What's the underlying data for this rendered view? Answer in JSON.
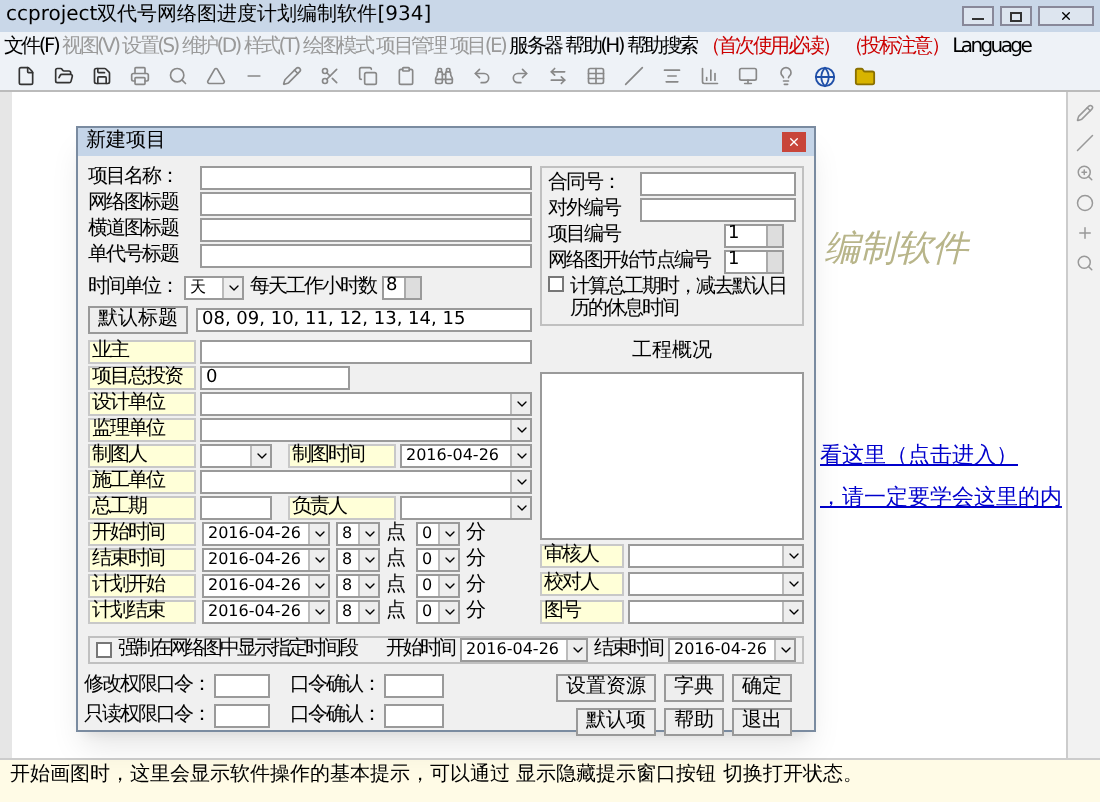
{
  "window": {
    "title": "ccproject双代号网络图进度计划编制软件[934]"
  },
  "menu": [
    {
      "label": "文件(F)",
      "disabled": false
    },
    {
      "label": "视图(V)",
      "disabled": true
    },
    {
      "label": "设置(S)",
      "disabled": true
    },
    {
      "label": "维护(D)",
      "disabled": true
    },
    {
      "label": "样式(T)",
      "disabled": true
    },
    {
      "label": "绘图模式",
      "disabled": true
    },
    {
      "label": "项目管理",
      "disabled": true
    },
    {
      "label": "项目(E)",
      "disabled": true
    },
    {
      "label": "服务器",
      "disabled": false
    },
    {
      "label": "帮助(H)",
      "disabled": false
    },
    {
      "label": "帮助搜索",
      "disabled": false
    },
    {
      "label": "（首次使用必读）",
      "disabled": false,
      "color": "#cc0000"
    },
    {
      "label": "（投标注意）",
      "disabled": false,
      "color": "#cc0000"
    },
    {
      "label": "Language",
      "disabled": false
    }
  ],
  "canvas": {
    "heading": "编制软件",
    "links": [
      "看这里（点击进入）",
      "，请一定要学会这里的内"
    ]
  },
  "dialog": {
    "title": "新建项目",
    "title_fields": [
      {
        "label": "项目名称："
      },
      {
        "label": "网络图标题"
      },
      {
        "label": "横道图标题"
      },
      {
        "label": "单代号标题"
      }
    ],
    "time_unit": {
      "label": "时间单位：",
      "value": "天"
    },
    "hours": {
      "label": "每天工作小时数",
      "value": "8"
    },
    "default_title_button": "默认标题",
    "hour_list": "08, 09, 10, 11, 12, 13, 14, 15",
    "rows": [
      {
        "kind": "text",
        "label": "业主"
      },
      {
        "kind": "number",
        "label": "项目总投资",
        "value": "0"
      },
      {
        "kind": "combo",
        "label": "设计单位"
      },
      {
        "kind": "combo",
        "label": "监理单位"
      },
      {
        "kind": "pair",
        "label": "制图人",
        "right_label": "制图时间",
        "right_value": "2016-04-26"
      },
      {
        "kind": "combo",
        "label": "施工单位"
      },
      {
        "kind": "pair_text",
        "label": "总工期",
        "right_label": "负责人"
      }
    ],
    "time_rows": [
      {
        "label": "开始时间",
        "date": "2016-04-26",
        "hour": "8",
        "hour_unit": "点",
        "minute": "0",
        "minute_unit": "分"
      },
      {
        "label": "结束时间",
        "date": "2016-04-26",
        "hour": "8",
        "hour_unit": "点",
        "minute": "0",
        "minute_unit": "分"
      },
      {
        "label": "计划开始",
        "date": "2016-04-26",
        "hour": "8",
        "hour_unit": "点",
        "minute": "0",
        "minute_unit": "分"
      },
      {
        "label": "计划结束",
        "date": "2016-04-26",
        "hour": "8",
        "hour_unit": "点",
        "minute": "0",
        "minute_unit": "分"
      }
    ],
    "right_fields": [
      {
        "label": "合同号："
      },
      {
        "label": "对外编号"
      }
    ],
    "spins": [
      {
        "label": "项目编号",
        "value": "1"
      },
      {
        "label": "网络图开始节点编号",
        "value": "1"
      }
    ],
    "rest_checkbox": {
      "label": "计算总工期时，减去默认日历的休息时间",
      "checked": false
    },
    "overview_label": "工程概况",
    "right_combos": [
      {
        "label": "审核人"
      },
      {
        "label": "校对人"
      },
      {
        "label": "图号"
      }
    ],
    "period": {
      "label": "强制在网络图中显示指定时间段",
      "checked": false,
      "start_label": "开始时间",
      "start": "2016-04-26",
      "end_label": "结束时间",
      "end": "2016-04-26"
    },
    "passwords": [
      {
        "label": "修改权限口令：",
        "confirm_label": "口令确认："
      },
      {
        "label": "只读权限口令：",
        "confirm_label": "口令确认："
      }
    ],
    "buttons": [
      [
        "设置资源",
        "字典",
        "确定"
      ],
      [
        "默认项",
        "帮助",
        "退出"
      ]
    ]
  },
  "status_bar": "开始画图时，这里会显示软件操作的基本提示，可以通过 显示隐藏提示窗口按钮 切换打开状态。"
}
